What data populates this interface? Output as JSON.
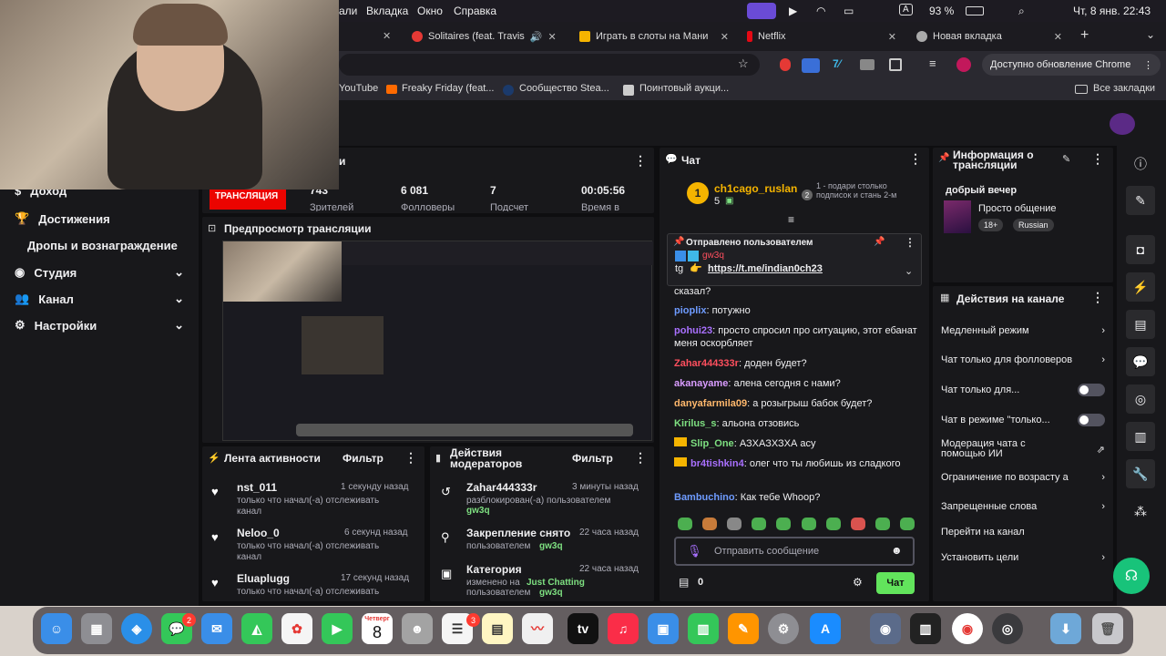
{
  "menubar": {
    "items": [
      "али",
      "Вкладка",
      "Окно",
      "Справка"
    ],
    "battery": "93 %",
    "datetime": "Чт, 8 янв.  22:43",
    "input_lang": "A"
  },
  "tabs": [
    {
      "label": "Solitaires (feat. Travis",
      "color": "#e53935"
    },
    {
      "label": "Играть в слоты на Мани",
      "color": "#f5b400"
    },
    {
      "label": "Netflix",
      "color": "#e50914"
    },
    {
      "label": "Новая вкладка",
      "color": "#aaaaaa"
    }
  ],
  "new_tab": "+",
  "toolbar": {
    "update_label": "Доступно обновление Chrome"
  },
  "bookmarks": {
    "items": [
      "YouTube",
      "Freaky Friday (feat...",
      "Сообщество Stea...",
      "Поинтовый аукци..."
    ],
    "all": "Все закладки"
  },
  "sidebar": {
    "items": [
      "Доход",
      "Достижения",
      "Дропы и вознаграждение",
      "Студия",
      "Канал",
      "Настройки"
    ]
  },
  "stats": {
    "title": "и",
    "live_badge": "ИДЕТ ТРАНСЛЯЦИЯ",
    "values": [
      "743",
      "6 081",
      "7",
      "00:05:56"
    ],
    "labels": [
      "Зрителей",
      "Фолловеры",
      "Подсчет",
      "Время в"
    ]
  },
  "preview": {
    "title": "Предпросмотр трансляции"
  },
  "activity": {
    "title": "Лента активности",
    "filter": "Фильтр",
    "items": [
      {
        "name": "nst_011",
        "time": "1 секунду назад",
        "text": "только что начал(-а) отслеживать канал"
      },
      {
        "name": "Neloo_0",
        "time": "6 секунд назад",
        "text": "только что начал(-а) отслеживать канал"
      },
      {
        "name": "Eluaplugg",
        "time": "17 секунд назад",
        "text": "только что начал(-а) отслеживать"
      }
    ]
  },
  "modactions": {
    "title": "Действия модераторов",
    "filter": "Фильтр",
    "items": [
      {
        "name": "Zahar444333r",
        "time": "3 минуты назад",
        "text": "разблокирован(-а) пользователем",
        "by": "gw3q"
      },
      {
        "name": "Закрепление снято",
        "time": "22 часа назад",
        "text": "пользователем",
        "by": "gw3q"
      },
      {
        "name": "Категория",
        "time": "22 часа назад",
        "text": "изменено на",
        "cat": "Just Chatting",
        "text2": "пользователем",
        "by": "gw3q"
      }
    ]
  },
  "chat": {
    "title": "Чат",
    "leader": {
      "rank": "1",
      "name": "ch1cago_ruslan",
      "count": "5",
      "gift_num": "2",
      "promo": "1 - подари столько подписок и стань 2-м"
    },
    "pinned": {
      "header": "Отправлено пользователем",
      "user": "gw3q",
      "text": "tg",
      "link": "https://t.me/indian0ch23"
    },
    "messages": [
      {
        "user": "",
        "color": "#efeff1",
        "text": "сказал?"
      },
      {
        "user": "pioplix",
        "color": "#6e9bff",
        "text": "потужно"
      },
      {
        "user": "pohui23",
        "color": "#a970ff",
        "text": "просто спросил про ситуацию, этот ебанат меня оскорбляет"
      },
      {
        "user": "Zahar444333r",
        "color": "#ff4f5e",
        "text": "доден будет?"
      },
      {
        "user": "akanayame",
        "color": "#d99cff",
        "text": "алена сегодня с нами?"
      },
      {
        "user": "danyafarmila09",
        "color": "#ffb86c",
        "text": "а розыгрыш бабок будет?"
      },
      {
        "user": "Kirilus_s",
        "color": "#7ee081",
        "text": "альона отзовись"
      },
      {
        "user": "Slip_One",
        "color": "#7ee081",
        "text": "АЗХАЗХЗХА асу"
      },
      {
        "user": "br4tishkin4",
        "color": "#a970ff",
        "text": "олег что ты любишь из сладкого"
      },
      {
        "user": "Bambuchino",
        "color": "#6e9bff",
        "text": "Как тебе Whoop?"
      }
    ],
    "input_placeholder": "Отправить сообщение",
    "points": "0",
    "send": "Чат"
  },
  "streaminfo": {
    "title": "Информация о трансляции",
    "stream_title": "добрый вечер",
    "category": "Просто общение",
    "tags": [
      "18+",
      "Russian"
    ]
  },
  "channelactions": {
    "title": "Действия на канале",
    "items": [
      {
        "label": "Медленный режим",
        "kind": "arrow"
      },
      {
        "label": "Чат только для фолловеров",
        "kind": "arrow"
      },
      {
        "label": "Чат только для...",
        "kind": "toggle"
      },
      {
        "label": "Чат в режиме \"только...",
        "kind": "toggle"
      },
      {
        "label": "Модерация чата с помощью ИИ",
        "kind": "ext"
      },
      {
        "label": "Ограничение по возрасту а",
        "kind": "arrow"
      },
      {
        "label": "Запрещенные слова",
        "kind": "arrow"
      },
      {
        "label": "Перейти на канал",
        "kind": "none"
      },
      {
        "label": "Установить цели",
        "kind": "arrow"
      }
    ]
  },
  "dock": {
    "calendar_month": "Четверг",
    "calendar_day": "8",
    "badges": [
      "2",
      "3"
    ]
  },
  "colors": {
    "accent": "#9147ff",
    "chat_button": "#62e45c",
    "live": "#eb0400"
  }
}
